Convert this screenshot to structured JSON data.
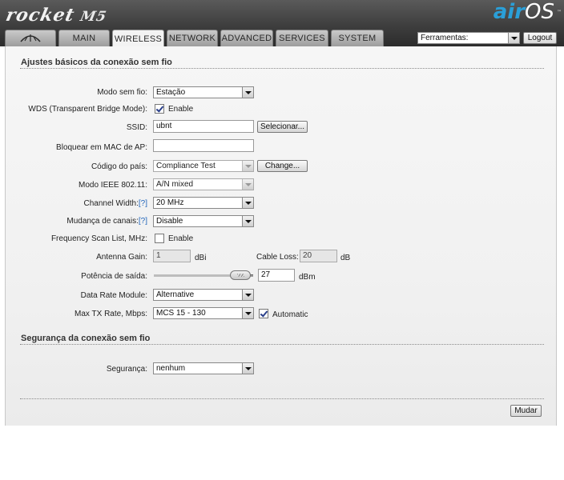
{
  "header": {
    "brand": "rocket",
    "model": "M5",
    "os_prefix": "air",
    "os_suffix": "OS",
    "trademark": "™"
  },
  "tabs": [
    {
      "label": "",
      "icon": "ubiquiti-logo-icon"
    },
    {
      "label": "MAIN"
    },
    {
      "label": "WIRELESS",
      "active": true
    },
    {
      "label": "NETWORK"
    },
    {
      "label": "ADVANCED"
    },
    {
      "label": "SERVICES"
    },
    {
      "label": "SYSTEM"
    }
  ],
  "tools": {
    "selected": "Ferramentas:",
    "logout_label": "Logout"
  },
  "basic": {
    "title": "Ajustes básicos da conexão sem fio",
    "wireless_mode": {
      "label": "Modo sem fio:",
      "value": "Estação"
    },
    "wds": {
      "label": "WDS (Transparent Bridge Mode):",
      "checked": true,
      "option": "Enable"
    },
    "ssid": {
      "label": "SSID:",
      "value": "ubnt",
      "button": "Selecionar..."
    },
    "lock_ap": {
      "label": "Bloquear em MAC de AP:",
      "value": ""
    },
    "country": {
      "label": "Código do país:",
      "value": "Compliance Test",
      "button": "Change..."
    },
    "ieee_mode": {
      "label": "Modo IEEE 802.11:",
      "value": "A/N mixed"
    },
    "channel_width": {
      "label": "Channel Width:",
      "help": "[?]",
      "value": "20 MHz"
    },
    "channel_shift": {
      "label": "Mudança de canais:",
      "help": "[?]",
      "value": "Disable"
    },
    "freq_scan": {
      "label": "Frequency Scan List, MHz:",
      "checked": false,
      "option": "Enable"
    },
    "antenna_gain": {
      "label": "Antenna Gain:",
      "value": "1",
      "unit": "dBi"
    },
    "cable_loss": {
      "label": "Cable Loss:",
      "value": "20",
      "unit": "dB"
    },
    "output_power": {
      "label": "Potência de saída:",
      "value": "27",
      "unit": "dBm",
      "level": 0.9
    },
    "data_rate_module": {
      "label": "Data Rate Module:",
      "value": "Alternative"
    },
    "max_tx_rate": {
      "label": "Max TX Rate, Mbps:",
      "value": "MCS 15 - 130",
      "auto_checked": true,
      "auto_label": "Automatic"
    }
  },
  "security": {
    "title": "Segurança da conexão sem fio",
    "mode": {
      "label": "Segurança:",
      "value": "nenhum"
    }
  },
  "footer": {
    "apply_label": "Mudar"
  }
}
